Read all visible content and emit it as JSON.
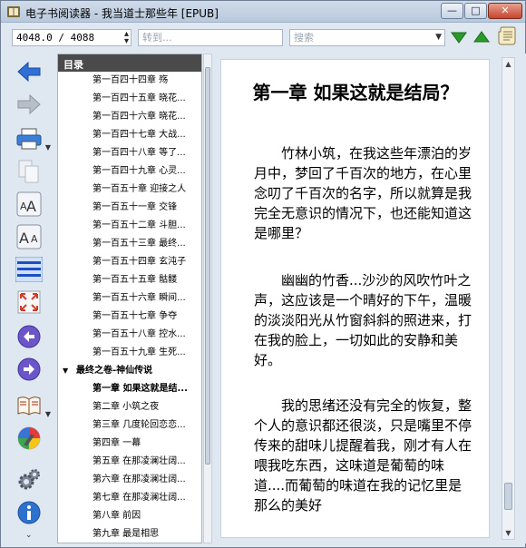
{
  "window": {
    "title": "电子书阅读器 - 我当道士那些年 [EPUB]",
    "minimize_glyph": "—",
    "maximize_glyph": "□",
    "close_glyph": "✕"
  },
  "toolbar": {
    "position_value": "4048.0 / 4088",
    "goto_placeholder": "转到...",
    "search_placeholder": "搜索",
    "icons": [
      "down-arrow-icon",
      "up-arrow-icon",
      "scroll-icon"
    ]
  },
  "sidebar_icons": [
    "back-arrow-icon",
    "forward-arrow-icon",
    "print-icon",
    "copy-icon",
    "font-larger-icon",
    "font-smaller-icon",
    "line-spacing-icon",
    "fullscreen-icon",
    "previous-icon",
    "next-icon",
    "book-icon",
    "color-icon",
    "settings-icon",
    "info-icon"
  ],
  "toc": {
    "header": "目录",
    "items": [
      {
        "label": "第一百四十四章 殇"
      },
      {
        "label": "第一百四十五章 晓花..."
      },
      {
        "label": "第一百四十六章 晓花..."
      },
      {
        "label": "第一百四十七章 大战..."
      },
      {
        "label": "第一百四十八章 等了..."
      },
      {
        "label": "第一百四十九章 心灵..."
      },
      {
        "label": "第一百五十章 迎接之人"
      },
      {
        "label": "第一百五十一章 交锋"
      },
      {
        "label": "第一百五十二章 斗胆..."
      },
      {
        "label": "第一百五十三章 最终..."
      },
      {
        "label": "第一百五十四章 玄沌子"
      },
      {
        "label": "第一百五十五章 骷髅"
      },
      {
        "label": "第一百五十六章 瞬间..."
      },
      {
        "label": "第一百五十七章 争夺"
      },
      {
        "label": "第一百五十八章 控水..."
      },
      {
        "label": "第一百五十九章 生死..."
      },
      {
        "label": "最终之卷-神仙传说"
      },
      {
        "label": "第一章  如果这就是结..."
      },
      {
        "label": "第二章 小筑之夜"
      },
      {
        "label": "第三章 几度轮回恋恋..."
      },
      {
        "label": "第四章 一幕"
      },
      {
        "label": "第五章 在那凌澜壮阔..."
      },
      {
        "label": "第六章 在那凌澜壮阔..."
      },
      {
        "label": "第七章 在那凌澜壮阔..."
      },
      {
        "label": "第八章 前因"
      },
      {
        "label": "第九章 最是相思"
      }
    ]
  },
  "content": {
    "chapter_title": "第一章  如果这就是结局？",
    "paragraphs": [
      "竹林小筑，在我这些年漂泊的岁月中，梦回了千百次的地方，在心里念叨了千百次的名字，所以就算是我完全无意识的情况下，也还能知道这是哪里？",
      "幽幽的竹香...沙沙的风吹竹叶之声，这应该是一个晴好的下午，温暖的淡淡阳光从竹窗斜斜的照进来，打在我的脸上，一切如此的安静和美好。",
      "我的思绪还没有完全的恢复，整个人的意识都还很淡，只是嘴里不停传来的甜味儿提醒着我，刚才有人在喂我吃东西，这味道是葡萄的味道....而葡萄的味道在我的记忆里是那么的美好"
    ]
  }
}
